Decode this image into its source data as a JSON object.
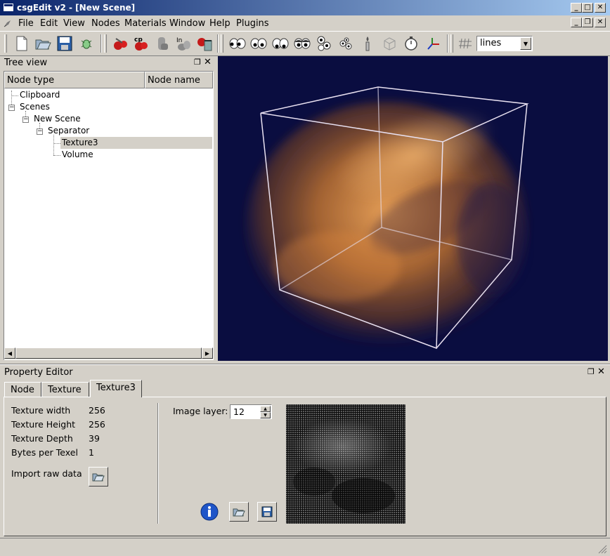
{
  "window": {
    "title": "csgEdit v2 - [New Scene]"
  },
  "menu": [
    "File",
    "Edit",
    "View",
    "Nodes",
    "Materials",
    "Window",
    "Help",
    "Plugins"
  ],
  "toolbar": {
    "render_mode": "lines",
    "icons": [
      "new-document-icon",
      "open-folder-icon",
      "save-disk-icon",
      "bug-icon",
      "cut-icon",
      "copy-icon",
      "paste-icon",
      "paste-into-icon",
      "delete-icon",
      "eyes-look-left-icon",
      "eyes-look-front-icon",
      "eyes-look-down-icon",
      "eyes-look-back-icon",
      "eyes-rotate-icon",
      "eyes-iso-icon",
      "candle-icon",
      "wireframe-cube-icon",
      "stopwatch-icon",
      "axes-icon",
      "grid-icon"
    ]
  },
  "tree_view": {
    "title": "Tree view",
    "columns": [
      "Node type",
      "Node name"
    ],
    "rows": [
      {
        "label": "Clipboard",
        "level": 0,
        "expander": ""
      },
      {
        "label": "Scenes",
        "level": 0,
        "expander": "−"
      },
      {
        "label": "New Scene",
        "level": 1,
        "expander": "−"
      },
      {
        "label": "Separator",
        "level": 2,
        "expander": "−"
      },
      {
        "label": "Texture3",
        "level": 3,
        "expander": "",
        "selected": true
      },
      {
        "label": "Volume",
        "level": 3,
        "expander": ""
      }
    ]
  },
  "property_editor": {
    "title": "Property Editor",
    "tabs": [
      "Node",
      "Texture",
      "Texture3"
    ],
    "active_tab": "Texture3",
    "properties": [
      {
        "label": "Texture width",
        "value": "256"
      },
      {
        "label": "Texture Height",
        "value": "256"
      },
      {
        "label": "Texture Depth",
        "value": "39"
      },
      {
        "label": "Bytes per Texel",
        "value": "1"
      }
    ],
    "import_label": "Import raw data",
    "image_layer_label": "Image layer:",
    "image_layer_value": "12"
  },
  "colors": {
    "title_start": "#0a246a",
    "title_end": "#a6caf0",
    "viewport_bg": "#0a0d40",
    "volume_orange": "#d9883a",
    "selection": "#d4d0c8"
  }
}
